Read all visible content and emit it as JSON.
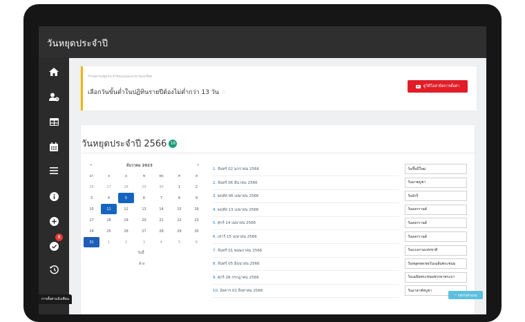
{
  "header": {
    "title": "วันหยุดประจำปี"
  },
  "sidebar": {
    "icons": [
      "home-icon",
      "user-clock-icon",
      "table-icon",
      "calendar-icon",
      "menu-icon",
      "info-icon",
      "plus-circle-icon",
      "check-circle-icon",
      "history-icon"
    ],
    "notification_count": "8",
    "bottom_label": "การตั้งค่าแจ้งเตือน"
  },
  "notice": {
    "hint": "กำหนดวันหยุดประจำปีของแต่ละสาขาของบริษัท",
    "message": "เลือกวันขั้นต่ำในปฏิทินรายปีต้องไม่ต่ำกว่า 13 วัน",
    "star": "☆",
    "video_button": "ดูวิดีโอสาธิตการตั้งค่า"
  },
  "holidays_section": {
    "title": "วันหยุดประจำปี 2566",
    "count": "16"
  },
  "calendar": {
    "prev": "«",
    "month": "ธันวาคม 2023",
    "next": "»",
    "weekdays": [
      "อา",
      "จ",
      "อ",
      "พ",
      "พฤ",
      "ศ",
      "ส"
    ],
    "weeks": [
      [
        "26",
        "27",
        "28",
        "29",
        "30",
        "1",
        "2"
      ],
      [
        "3",
        "4",
        "5",
        "6",
        "7",
        "8",
        "9"
      ],
      [
        "10",
        "11",
        "12",
        "13",
        "14",
        "15",
        "16"
      ],
      [
        "17",
        "18",
        "19",
        "20",
        "21",
        "22",
        "23"
      ],
      [
        "24",
        "25",
        "26",
        "27",
        "28",
        "29",
        "30"
      ],
      [
        "31",
        "1",
        "2",
        "3",
        "4",
        "5",
        "6"
      ]
    ],
    "today_label": "วันนี้",
    "clear_label": "ล้าง"
  },
  "holidays": [
    {
      "index": "1.",
      "date": "จันทร์ 02 มกราคม 2566",
      "name": "วันขึ้นปีใหม่"
    },
    {
      "index": "2.",
      "date": "จันทร์ 06 มีนาคม 2566",
      "name": "วันมาฆบูชา"
    },
    {
      "index": "3.",
      "date": "พฤหัส 06 เมษายน 2566",
      "name": "วันจักรี"
    },
    {
      "index": "4.",
      "date": "พฤหัส 13 เมษายน 2566",
      "name": "วันสงกรานต์"
    },
    {
      "index": "5.",
      "date": "ศุกร์ 14 เมษายน 2566",
      "name": "วันสงกรานต์"
    },
    {
      "index": "6.",
      "date": "เสาร์ 15 เมษายน 2566",
      "name": "วันสงกรานต์"
    },
    {
      "index": "7.",
      "date": "จันทร์ 01 พฤษภาคม 2566",
      "name": "วันแรงงานแห่งชาติ"
    },
    {
      "index": "8.",
      "date": "จันทร์ 05 มิถุนายน 2566",
      "name": "วันหยุดชดเชยวันเฉลิมพระชนม"
    },
    {
      "index": "9.",
      "date": "ศุกร์ 28 กรกฎาคม 2566",
      "name": "วันเฉลิมพระชนมพรรษาพระบา"
    },
    {
      "index": "10.",
      "date": "อังคาร 01 สิงหาคม 2566",
      "name": "วันอาสาฬหบูชา"
    }
  ],
  "back_to_top": "^ กลับไปด้านบน"
}
